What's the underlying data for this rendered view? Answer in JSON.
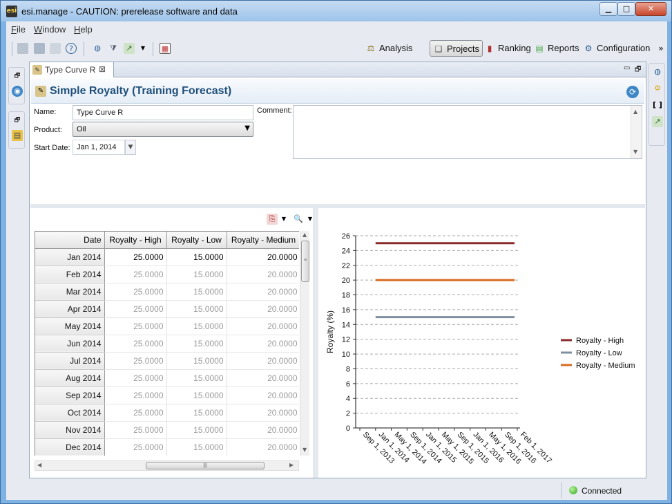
{
  "window": {
    "title": "esi.manage - CAUTION: prerelease software and data",
    "app_icon": "esi",
    "minimize": "▁",
    "maximize": "□",
    "close": "✕"
  },
  "menu": [
    {
      "label": "File",
      "mnemonic": "F",
      "rest": "ile"
    },
    {
      "label": "Window",
      "mnemonic": "W",
      "rest": "indow"
    },
    {
      "label": "Help",
      "mnemonic": "H",
      "rest": "elp"
    }
  ],
  "toolbar": {
    "perspectives": [
      {
        "label": "Analysis",
        "icon": "analysis-scale-icon"
      },
      {
        "label": "Projects",
        "icon": "projects-icon"
      },
      {
        "label": "Ranking",
        "icon": "ranking-icon"
      },
      {
        "label": "Reports",
        "icon": "reports-icon"
      },
      {
        "label": "Configuration",
        "icon": "configuration-icon"
      }
    ],
    "overflow": "»"
  },
  "editor": {
    "tab": {
      "label": "Type Curve R",
      "close": "⊠"
    },
    "form_title": "Simple Royalty (Training Forecast)",
    "fields": {
      "name": {
        "label": "Name:",
        "value": "Type Curve R"
      },
      "product": {
        "label": "Product:",
        "value": "Oil"
      },
      "start_date": {
        "label": "Start Date:",
        "value": "Jan 1, 2014"
      },
      "comment": {
        "label": "Comment:",
        "value": ""
      }
    }
  },
  "grid": {
    "columns": [
      "Date",
      "Royalty - High",
      "Royalty - Low",
      "Royalty - Medium"
    ],
    "rows": [
      {
        "date": "Jan 2014",
        "high": "25.0000",
        "low": "15.0000",
        "medium": "20.0000"
      },
      {
        "date": "Feb 2014",
        "high": "25.0000",
        "low": "15.0000",
        "medium": "20.0000"
      },
      {
        "date": "Mar 2014",
        "high": "25.0000",
        "low": "15.0000",
        "medium": "20.0000"
      },
      {
        "date": "Apr 2014",
        "high": "25.0000",
        "low": "15.0000",
        "medium": "20.0000"
      },
      {
        "date": "May 2014",
        "high": "25.0000",
        "low": "15.0000",
        "medium": "20.0000"
      },
      {
        "date": "Jun 2014",
        "high": "25.0000",
        "low": "15.0000",
        "medium": "20.0000"
      },
      {
        "date": "Jul 2014",
        "high": "25.0000",
        "low": "15.0000",
        "medium": "20.0000"
      },
      {
        "date": "Aug 2014",
        "high": "25.0000",
        "low": "15.0000",
        "medium": "20.0000"
      },
      {
        "date": "Sep 2014",
        "high": "25.0000",
        "low": "15.0000",
        "medium": "20.0000"
      },
      {
        "date": "Oct 2014",
        "high": "25.0000",
        "low": "15.0000",
        "medium": "20.0000"
      },
      {
        "date": "Nov 2014",
        "high": "25.0000",
        "low": "15.0000",
        "medium": "20.0000"
      },
      {
        "date": "Dec 2014",
        "high": "25.0000",
        "low": "15.0000",
        "medium": "20.0000"
      }
    ]
  },
  "chart_data": {
    "type": "line",
    "title": "",
    "xlabel": "",
    "ylabel": "Royalty (%)",
    "x_ticks": [
      "Sep 1, 2013",
      "Jan 1, 2014",
      "May 1, 2014",
      "Sep 1, 2014",
      "Jan 1, 2015",
      "May 1, 2015",
      "Sep 1, 2015",
      "Jan 1, 2016",
      "May 1, 2016",
      "Sep 1, 2016",
      "Feb 1, 2017"
    ],
    "y_ticks": [
      0,
      2,
      4,
      6,
      8,
      10,
      12,
      14,
      16,
      18,
      20,
      22,
      24,
      26
    ],
    "ylim": [
      0,
      26
    ],
    "grid": true,
    "legend_position": "right",
    "x_range": [
      "Jan 1, 2014",
      "Jan 1, 2017"
    ],
    "series": [
      {
        "name": "Royalty - High",
        "color": "#8b2b2b",
        "x": [
          "Jan 1, 2014",
          "Jan 1, 2017"
        ],
        "y": [
          25,
          25
        ]
      },
      {
        "name": "Royalty - Low",
        "color": "#7f8fa0",
        "x": [
          "Jan 1, 2014",
          "Jan 1, 2017"
        ],
        "y": [
          15,
          15
        ]
      },
      {
        "name": "Royalty - Medium",
        "color": "#d86a1f",
        "x": [
          "Jan 1, 2014",
          "Jan 1, 2017"
        ],
        "y": [
          20,
          20
        ]
      }
    ]
  },
  "status": {
    "connection": "Connected",
    "color": "#2fa41f"
  }
}
